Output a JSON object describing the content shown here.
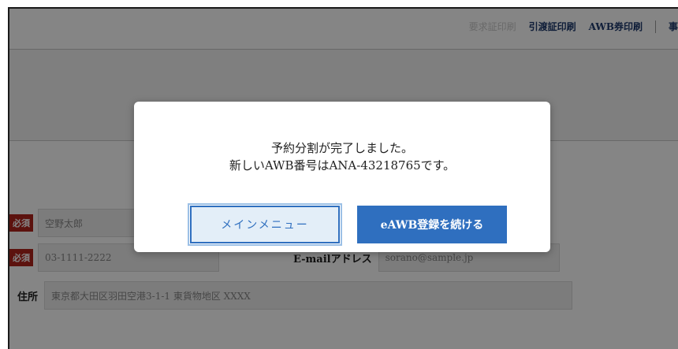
{
  "header": {
    "links": [
      "要求証印刷",
      "引渡証印刷",
      "AWB券印刷",
      "事"
    ]
  },
  "form": {
    "required_badge": "必須",
    "name_value": "空野太郎",
    "phone_value": "03-1111-2222",
    "email_label": "E-mailアドレス",
    "email_value": "sorano@sample.jp",
    "address_label": "住所",
    "address_value": "東京都大田区羽田空港3-1-1 東貨物地区 XXXX"
  },
  "modal": {
    "message_line1": "予約分割が完了しました。",
    "message_line2": "新しいAWB番号はANA-43218765です。",
    "main_menu_label": "メインメニュー",
    "continue_label": "eAWB登録を続ける"
  }
}
